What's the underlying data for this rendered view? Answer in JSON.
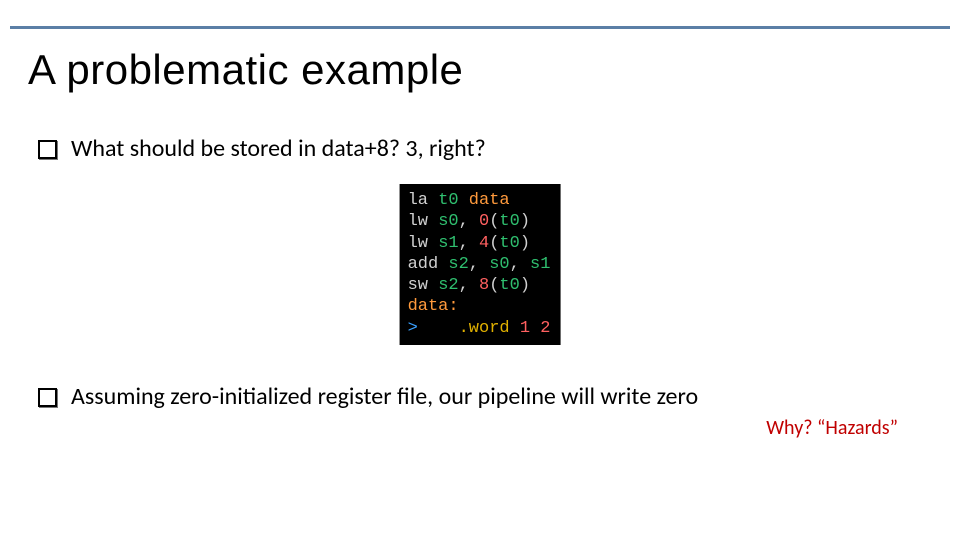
{
  "title": "A problematic example",
  "bullet1": "What should be stored in data+8? 3, right?",
  "bullet2": "Assuming zero-initialized register file, our pipeline will write zero",
  "why": "Why? “Hazards”",
  "code": {
    "l1": {
      "op": "la",
      "r1": "t0",
      "sym": "data"
    },
    "l2": {
      "op": "lw",
      "r1": "s0",
      "off": "0",
      "base": "t0"
    },
    "l3": {
      "op": "lw",
      "r1": "s1",
      "off": "4",
      "base": "t0"
    },
    "l4": {
      "op": "add",
      "r1": "s2",
      "r2": "s0",
      "r3": "s1"
    },
    "l5": {
      "op": "sw",
      "r1": "s2",
      "off": "8",
      "base": "t0"
    },
    "l6": {
      "label": "data:"
    },
    "l7": {
      "gt": ">",
      "dir": ".word",
      "v1": "1",
      "v2": "2"
    }
  }
}
